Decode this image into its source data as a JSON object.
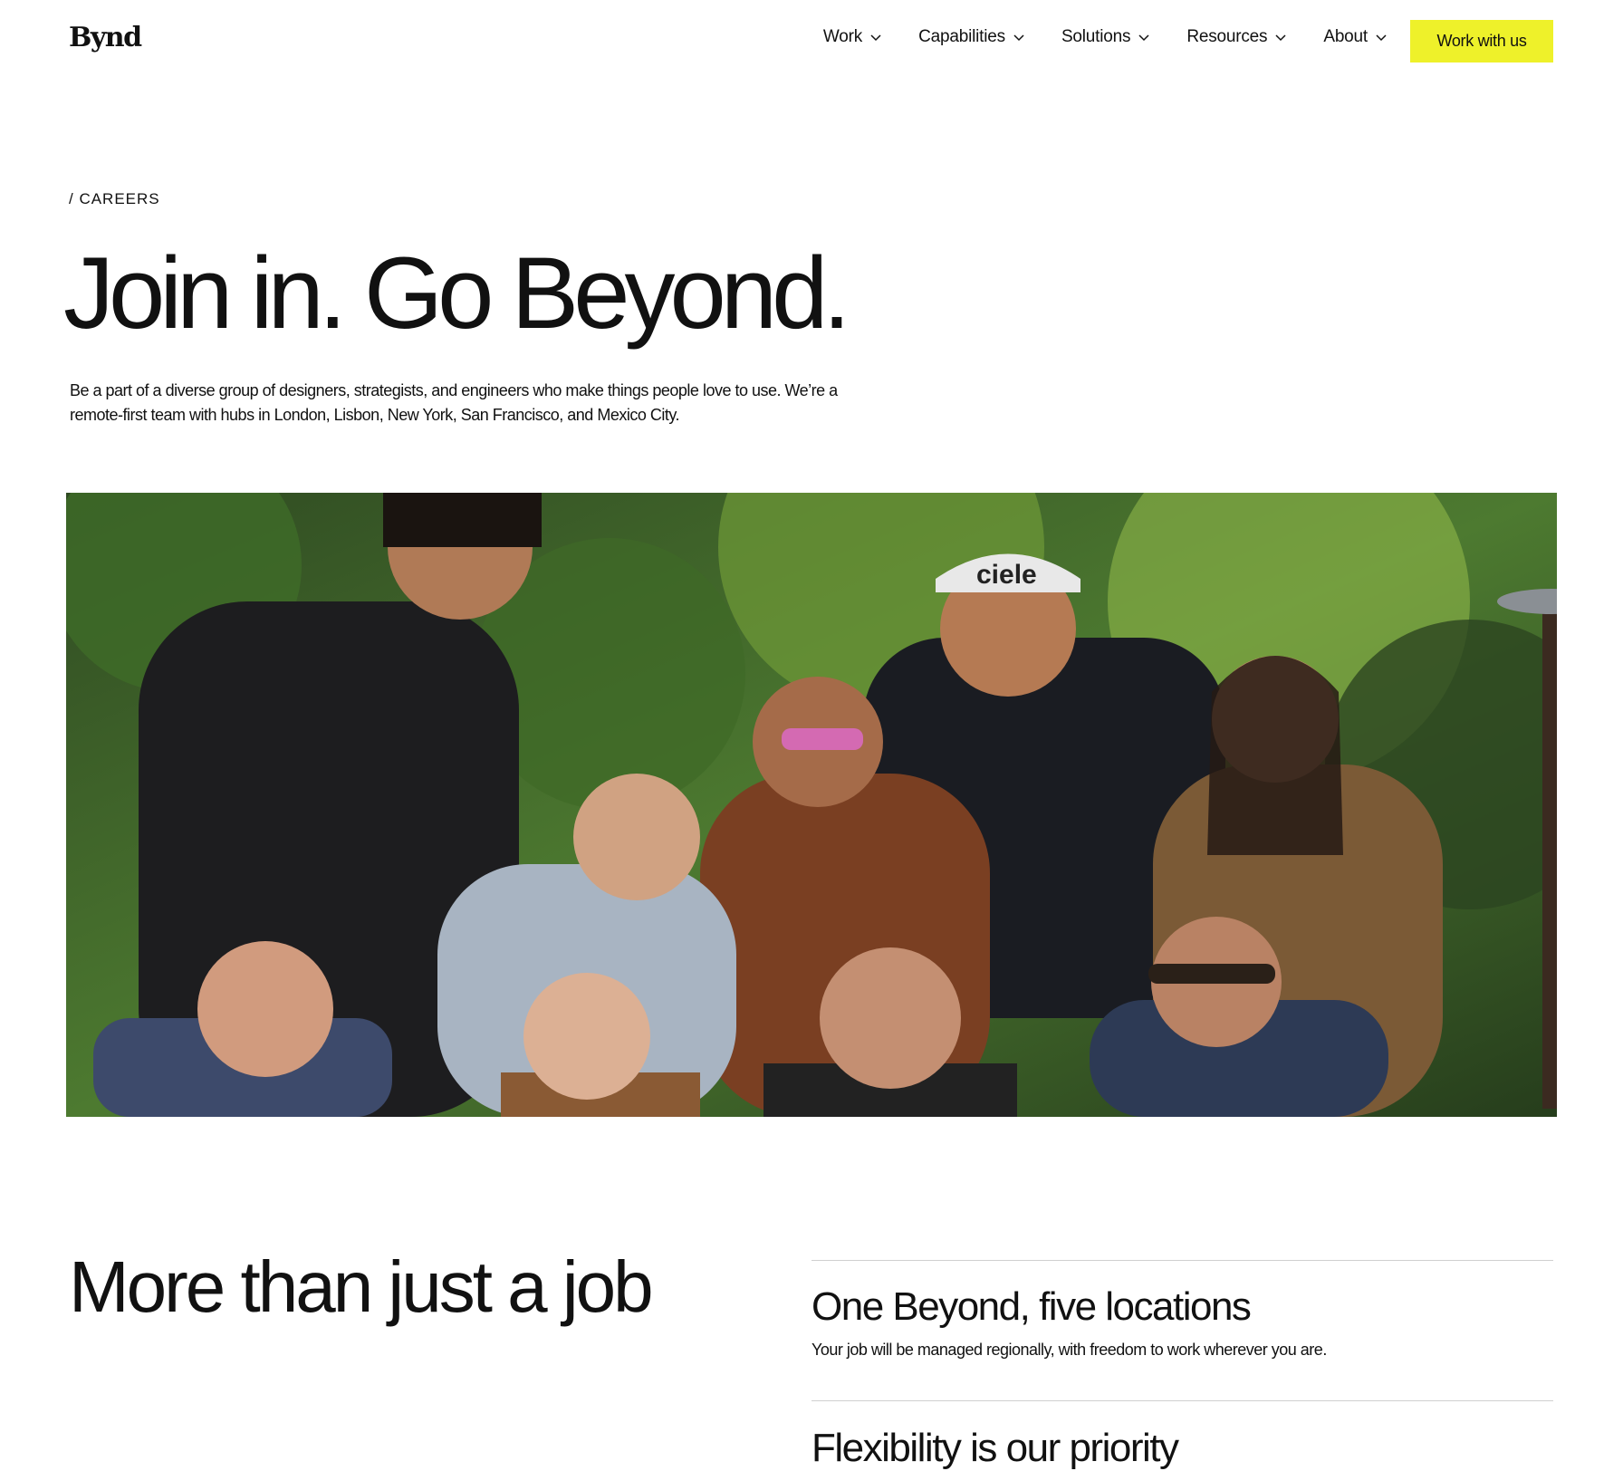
{
  "nav": {
    "logo": "Bynd",
    "items": [
      {
        "label": "Work",
        "icon": "chevron-down-icon"
      },
      {
        "label": "Capabilities",
        "icon": "chevron-down-icon"
      },
      {
        "label": "Solutions",
        "icon": "chevron-down-icon"
      },
      {
        "label": "Resources",
        "icon": "chevron-down-icon"
      },
      {
        "label": "About",
        "icon": "chevron-down-icon"
      }
    ],
    "cta_label": "Work with us"
  },
  "hero": {
    "eyebrow": "/ CAREERS",
    "title": "Join in. Go Beyond.",
    "description": "Be a part of a diverse group of designers, strategists, and engineers who make things people love to use. We’re a remote-first team with hubs in London, Lisbon, New York, San Francisco, and Mexico City."
  },
  "photo": {
    "cap_text": "ciele"
  },
  "section": {
    "title": "More than just a job",
    "features": [
      {
        "title": "One Beyond, five locations",
        "description": "Your job will be managed regionally, with freedom to work wherever you are."
      },
      {
        "title": "Flexibility is our priority",
        "description": ""
      }
    ]
  },
  "colors": {
    "accent": "#eef12a",
    "text": "#111111",
    "background": "#ffffff"
  }
}
